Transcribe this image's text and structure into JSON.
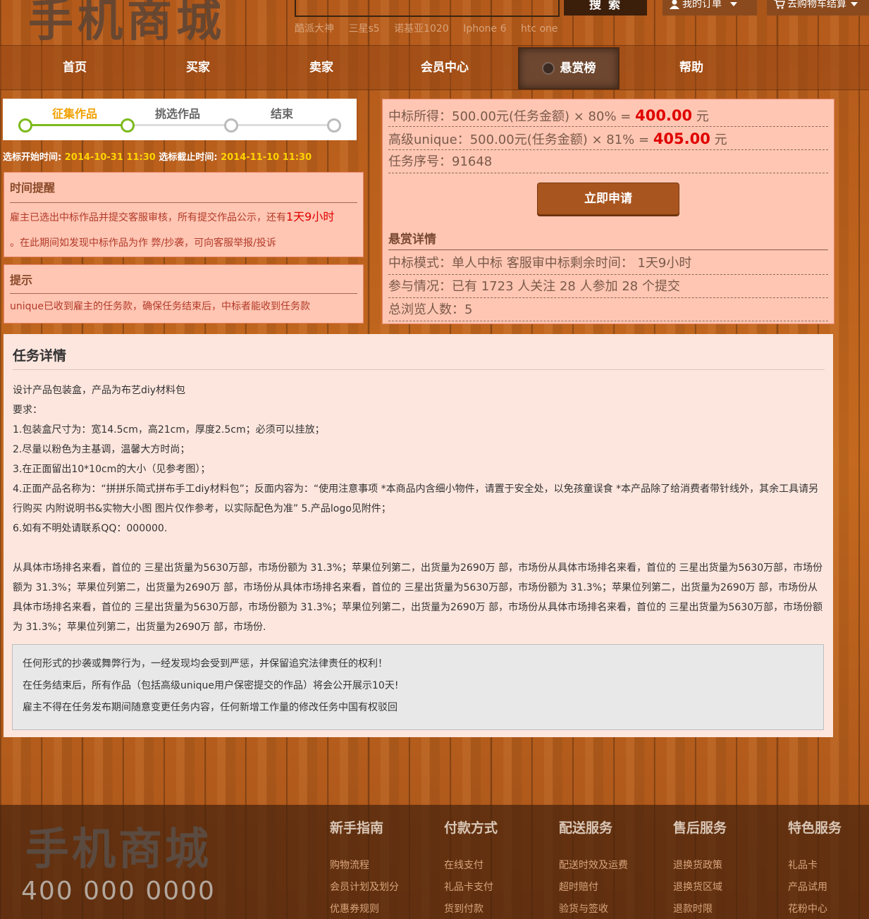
{
  "header": {
    "logo": "手机商城",
    "search_button": "搜 索",
    "hot_links": [
      "酷派大神",
      "三星s5",
      "诺基亚1020",
      "Iphone 6",
      "htc one"
    ],
    "my_orders": "我的订单",
    "cart": "去购物车结算"
  },
  "nav": {
    "items": [
      "首页",
      "买家",
      "卖家",
      "会员中心",
      "悬赏榜",
      "帮助"
    ],
    "active_index": 4
  },
  "progress": {
    "steps": [
      "征集作品",
      "挑选作品",
      "结束"
    ],
    "current": 0
  },
  "times": {
    "start_label": "选标开始时间:",
    "start_value": "2014-10-31 11:30",
    "end_label": "选标截止时间:",
    "end_value": "2014-11-10 11:30"
  },
  "time_reminder": {
    "title": "时间提醒",
    "text_before": "雇主已选出中标作品并提交客服审核，所有提交作品公示，还有",
    "highlight": "1天9小时",
    "text_after": "。在此期间如发现中标作品为作 弊/抄袭，可向客服举报/投诉"
  },
  "tips": {
    "title": "提示",
    "text": "unique已收到雇主的任务款，确保任务结束后，中标者能收到任务款"
  },
  "summary": {
    "win_prefix": "中标所得：500.00元(任务金额) × 80% = ",
    "win_amount": "400.00",
    "win_unit": " 元",
    "senior_prefix": "高级unique：500.00元(任务金额) × 81% = ",
    "senior_amount": "405.00",
    "senior_unit": " 元",
    "task_no": "任务序号：91648",
    "apply_button": "立即申请",
    "reward_title": "悬赏详情",
    "mode": "中标模式：单人中标 客服审中标剩余时间：  1天9小时",
    "participation": "参与情况：已有 1723 人关注 28 人参加 28 个提交",
    "views": "总浏览人数：5"
  },
  "detail": {
    "title": "任务详情",
    "lines": [
      "设计产品包装盒，产品为布艺diy材料包",
      "要求：",
      "1.包装盒尺寸为：宽14.5cm，高21cm，厚度2.5cm；必须可以挂放；",
      "2.尽量以粉色为主基调，温馨大方时尚；",
      "3.在正面留出10*10cm的大小（见参考图）；",
      "4.正面产品名称为：“拼拼乐简式拼布手工diy材料包”；反面内容为：“使用注意事项 *本商品内含细小物件，请置于安全处，以免孩童误食 *本产品除了给消费者带针线外，其余工具请另行购买 内附说明书&实物大小图 图片仅作参考，以实际配色为准” 5.产品logo见附件；",
      "6.如有不明处请联系QQ：000000."
    ],
    "paragraph": "从具体市场排名来看，首位的 三星出货量为5630万部，市场份额为 31.3%；苹果位列第二，出货量为2690万 部，市场份从具体市场排名来看，首位的 三星出货量为5630万部，市场份额为 31.3%；苹果位列第二，出货量为2690万 部，市场份从具体市场排名来看，首位的 三星出货量为5630万部，市场份额为 31.3%；苹果位列第二，出货量为2690万 部，市场份从具体市场排名来看，首位的 三星出货量为5630万部，市场份额为 31.3%；苹果位列第二，出货量为2690万 部，市场份从具体市场排名来看，首位的 三星出货量为5630万部，市场份额为 31.3%；苹果位列第二，出货量为2690万 部，市场份.",
    "notice": [
      "任何形式的抄袭或舞弊行为，一经发现均会受到严惩，并保留追究法律责任的权利！",
      "在任务结束后，所有作品（包括高级unique用户保密提交的作品）将会公开展示10天!",
      "雇主不得在任务发布期间随意变更任务内容，任何新增工作量的修改任务中国有权驳回"
    ]
  },
  "footer": {
    "logo": "手机商城",
    "phone": "400 000 0000",
    "columns": [
      {
        "title": "新手指南",
        "items": [
          "购物流程",
          "会员计划及划分",
          "优惠券规则"
        ]
      },
      {
        "title": "付款方式",
        "items": [
          "在线支付",
          "礼品卡支付",
          "货到付款"
        ]
      },
      {
        "title": "配送服务",
        "items": [
          "配送时效及运费",
          "超时赔付",
          "验货与签收"
        ]
      },
      {
        "title": "售后服务",
        "items": [
          "退换货政策",
          "退换货区域",
          "退款时限"
        ]
      },
      {
        "title": "特色服务",
        "items": [
          "礼品卡",
          "产品试用",
          "花粉中心"
        ]
      }
    ]
  }
}
